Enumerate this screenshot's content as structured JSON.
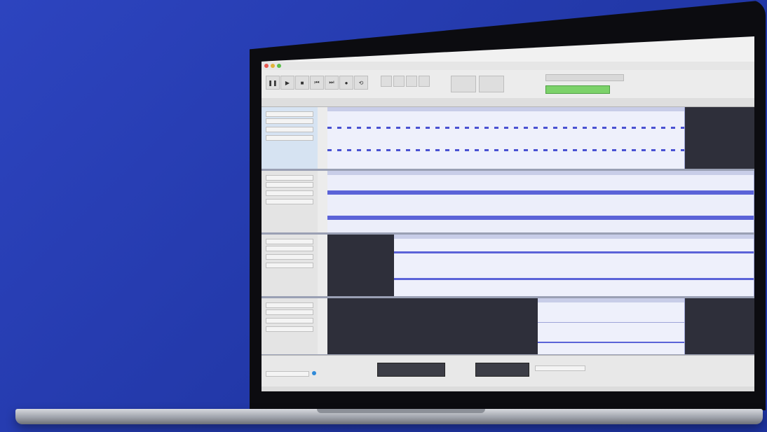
{
  "scene": {
    "background_color": "#2a3fb3",
    "device": "laptop"
  },
  "app": {
    "menu_items": [
      "",
      "",
      "",
      "",
      "",
      "",
      "",
      "",
      ""
    ],
    "toolbar_icons": [
      "pause-icon",
      "play-icon",
      "stop-icon",
      "skip-start-icon",
      "skip-end-icon",
      "record-icon",
      "loop-icon"
    ],
    "meter_color": "#7cd26a",
    "waveform_color": "#5b63d8"
  },
  "tracks": [
    {
      "selected": true
    },
    {
      "selected": false
    },
    {
      "selected": false
    },
    {
      "selected": false
    }
  ]
}
